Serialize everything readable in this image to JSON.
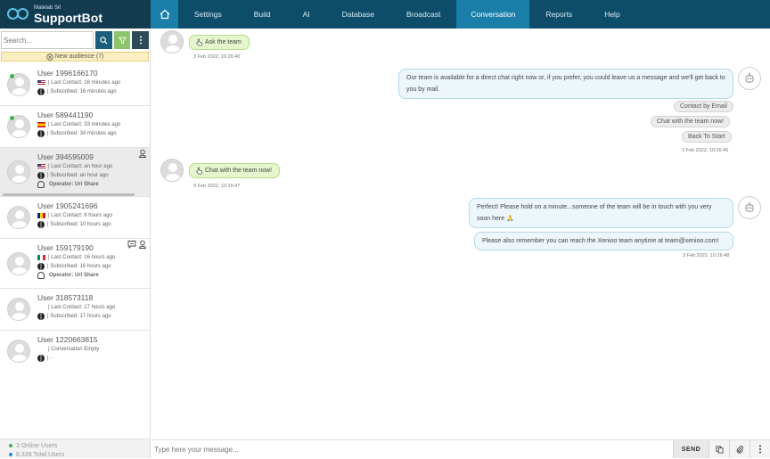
{
  "brand": {
    "company": "Matelab Srl",
    "name": "SupportBot"
  },
  "nav": {
    "home_icon": "home-icon",
    "items": [
      {
        "label": "Settings",
        "active": false
      },
      {
        "label": "Build",
        "active": false
      },
      {
        "label": "AI",
        "active": false
      },
      {
        "label": "Database",
        "active": false
      },
      {
        "label": "Broadcast",
        "active": false
      },
      {
        "label": "Conversation",
        "active": true
      },
      {
        "label": "Reports",
        "active": false
      },
      {
        "label": "Help",
        "active": false
      }
    ]
  },
  "sidebar": {
    "search": {
      "placeholder": "Search...",
      "value": ""
    },
    "audience_label": "New audience (7)",
    "users": [
      {
        "name": "User 1996166170",
        "flag": "US",
        "last_contact": "| Last Contact: 16 minutes ago",
        "subscribed": "| Subscribed: 16 minutes ago",
        "operator": "",
        "online": true
      },
      {
        "name": "User 589441190",
        "flag": "ES",
        "last_contact": "| Last Contact: 33 minutes ago",
        "subscribed": "| Subscribed: 34 minutes ago",
        "operator": "",
        "online": true
      },
      {
        "name": "User 394595009",
        "flag": "US",
        "last_contact": "| Last Contact: an hour ago",
        "subscribed": "| Subscribed: an hour ago",
        "operator": "Operator: Uri Share",
        "online": false
      },
      {
        "name": "User 1905241696",
        "flag": "RO",
        "last_contact": "| Last Contact: 8 hours ago",
        "subscribed": "| Subscribed: 10 hours ago",
        "operator": "",
        "online": false
      },
      {
        "name": "User 159179190",
        "flag": "IT",
        "last_contact": "| Last Contact: 16 hours ago",
        "subscribed": "| Subscribed: 16 hours ago",
        "operator": "Operator: Uri Share",
        "online": false
      },
      {
        "name": "User 318573118",
        "flag": "",
        "last_contact": "| Last Contact: 17 hours ago",
        "subscribed": "| Subscribed: 17 hours ago",
        "operator": "",
        "online": false
      },
      {
        "name": "User 1220663815",
        "flag": "",
        "last_contact": "| Conversation Empty",
        "subscribed": "| -",
        "operator": "",
        "online": false
      }
    ],
    "footer": {
      "online": "3 Online Users",
      "online_color": "#3fb34f",
      "total": "8.339 Total Users",
      "total_color": "#2a8fd6"
    }
  },
  "chat": {
    "messages": {
      "m1": {
        "text": "Ask the team",
        "time": "3 Feb 2022, 10:26:40"
      },
      "m2": {
        "text": "Our team is available for a direct chat right now or, if you prefer, you could leave us a message and we'll get back to you by mail.",
        "buttons": [
          "Contact by Email",
          "Chat with the team now!",
          "Back To Start"
        ],
        "time": "3 Feb 2022, 10:26:40"
      },
      "m3": {
        "text": "Chat with the team now!",
        "time": "3 Feb 2022, 10:26:47"
      },
      "m4": {
        "text": "Perfect! Please hold on a minute...someone of the team will be in touch with you very soon here 🙏"
      },
      "m5": {
        "text": "Please also remember you can reach the Xenioo team anytime at team@xenioo.com!",
        "time": "3 Feb 2022, 10:26:48"
      }
    }
  },
  "composer": {
    "placeholder": "Type here your message...",
    "value": "",
    "send_label": "SEND"
  },
  "colors": {
    "topbar": "#0e4d69",
    "active_tab": "#1a7fa8",
    "user_bubble": "#e5f6cc",
    "bot_bubble": "#edf6fb"
  }
}
